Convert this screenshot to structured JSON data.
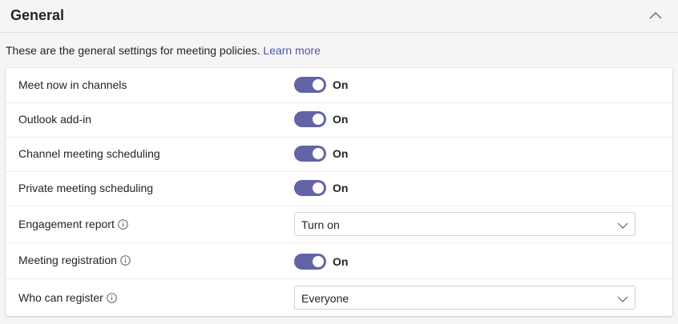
{
  "section": {
    "title": "General",
    "collapse_icon": "chevron-up-icon"
  },
  "description": {
    "text": "These are the general settings for meeting policies.",
    "link_text": "Learn more"
  },
  "settings": [
    {
      "label": "Meet now in channels",
      "type": "toggle",
      "value": "On",
      "enabled": true,
      "info": false
    },
    {
      "label": "Outlook add-in",
      "type": "toggle",
      "value": "On",
      "enabled": true,
      "info": false
    },
    {
      "label": "Channel meeting scheduling",
      "type": "toggle",
      "value": "On",
      "enabled": true,
      "info": false
    },
    {
      "label": "Private meeting scheduling",
      "type": "toggle",
      "value": "On",
      "enabled": true,
      "info": false
    },
    {
      "label": "Engagement report",
      "type": "dropdown",
      "value": "Turn on",
      "info": true
    },
    {
      "label": "Meeting registration",
      "type": "toggle",
      "value": "On",
      "enabled": true,
      "info": true
    },
    {
      "label": "Who can register",
      "type": "dropdown",
      "value": "Everyone",
      "info": true
    }
  ],
  "colors": {
    "toggle_on": "#6264a7",
    "link": "#4f52b2",
    "background": "#f5f5f5"
  }
}
